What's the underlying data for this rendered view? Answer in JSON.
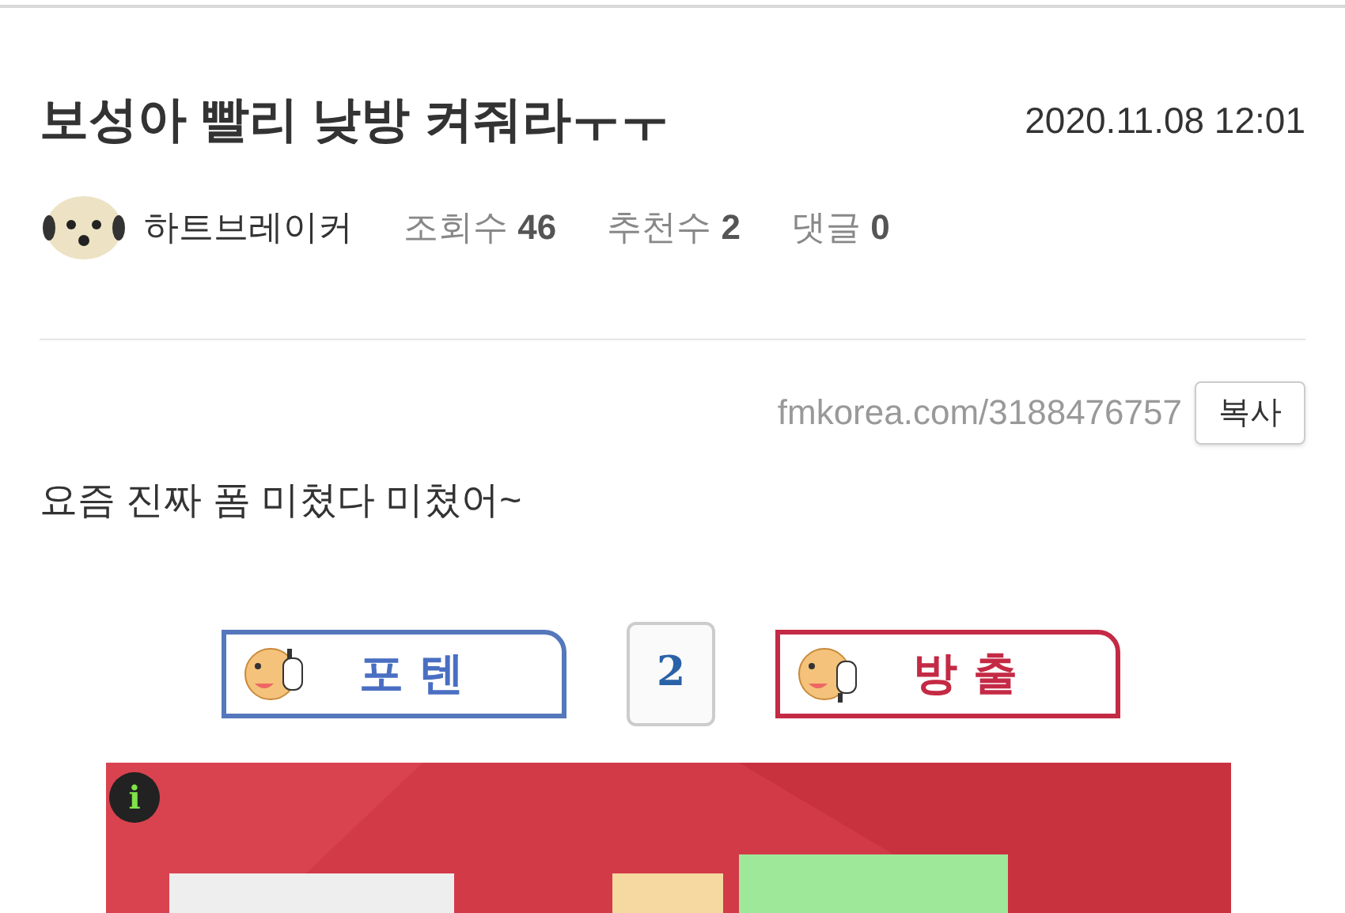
{
  "post": {
    "title": "보성아 빨리 낮방 켜줘라ㅜㅜ",
    "date": "2020.11.08 12:01",
    "author": "하트브레이커",
    "stats": [
      {
        "label": "조회수",
        "value": "46"
      },
      {
        "label": "추천수",
        "value": "2"
      },
      {
        "label": "댓글",
        "value": "0"
      }
    ],
    "url": "fmkorea.com/3188476757",
    "copy_button": "복사",
    "body": "요즘 진짜 폼 미쳤다 미쳤어~"
  },
  "votes": {
    "up": "포텐",
    "count": "2",
    "down": "방출"
  },
  "ad": {
    "kind": "picture",
    "info": "i"
  }
}
